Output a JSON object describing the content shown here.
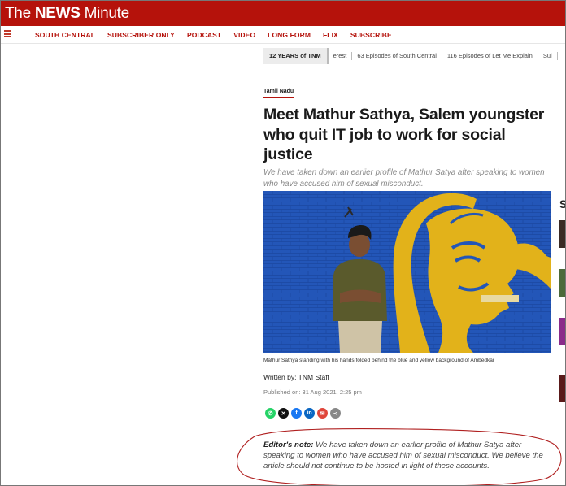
{
  "site": {
    "logo_pre": "The ",
    "logo_bold": "NEWS",
    "logo_post": " Minute"
  },
  "nav": {
    "menu_icon": "hamburger-icon",
    "items": [
      {
        "label": "SOUTH CENTRAL"
      },
      {
        "label": "SUBSCRIBER ONLY"
      },
      {
        "label": "PODCAST"
      },
      {
        "label": "VIDEO"
      },
      {
        "label": "LONG FORM"
      },
      {
        "label": "FLIX"
      },
      {
        "label": "SUBSCRIBE"
      }
    ]
  },
  "ticker": {
    "tag": "12 YEARS of TNM",
    "items": [
      "erest",
      "63 Episodes of South Central",
      "116 Episodes of Let Me Explain",
      "Sul"
    ]
  },
  "article": {
    "kicker": "Tamil Nadu",
    "headline": "Meet Mathur Sathya, Salem youngster who quit IT job to work for social justice",
    "standfirst": "We have taken down an earlier profile of Mathur Satya after speaking to women who have accused him of sexual misconduct.",
    "image_caption": "Mathur Sathya standing with his hands folded behind the blue and yellow background of Ambedkar",
    "byline": "Written by: TNM Staff",
    "published": "Published on: 31 Aug 2021, 2:25 pm",
    "editor_note_label": "Editor's note:",
    "editor_note_text": " We have taken down an earlier profile of Mathur Satya after speaking to women who have accused him of sexual misconduct. We believe the article should not continue to be hosted in light of these accounts."
  },
  "share": {
    "icons": [
      {
        "name": "whatsapp-icon",
        "glyph": "✆",
        "color": "#25d366"
      },
      {
        "name": "x-icon",
        "glyph": "✕",
        "color": "#111111"
      },
      {
        "name": "facebook-icon",
        "glyph": "f",
        "color": "#1877f2"
      },
      {
        "name": "linkedin-icon",
        "glyph": "in",
        "color": "#0a66c2"
      },
      {
        "name": "email-icon",
        "glyph": "✉",
        "color": "#e0463b"
      },
      {
        "name": "share-icon",
        "glyph": "≺",
        "color": "#888888"
      }
    ]
  },
  "rail": {
    "title": "S"
  },
  "colors": {
    "brand": "#b5120b",
    "annotation": "#b02020",
    "image_blue": "#2356b8",
    "mural_yellow": "#e2b21a"
  }
}
